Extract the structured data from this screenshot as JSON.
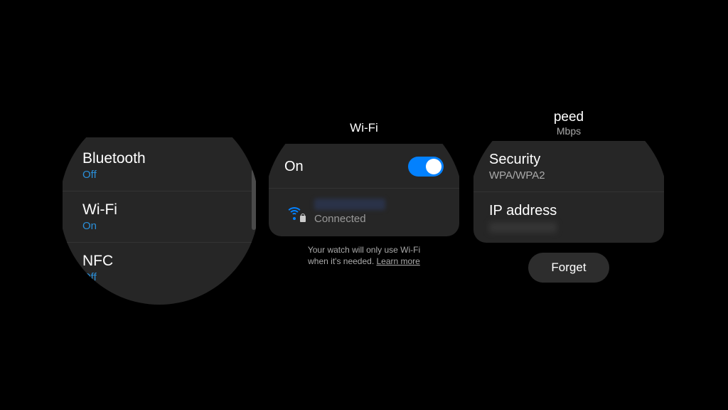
{
  "watch1": {
    "items": [
      {
        "title": "Bluetooth",
        "status": "Off"
      },
      {
        "title": "Wi-Fi",
        "status": "On"
      },
      {
        "title": "NFC",
        "status": "Off"
      }
    ]
  },
  "watch2": {
    "title": "Wi-Fi",
    "toggle": {
      "label": "On",
      "state": true
    },
    "network": {
      "status": "Connected"
    },
    "footer_line1": "Your watch will only use Wi-Fi",
    "footer_line2": "when it's needed. ",
    "learn_more": "Learn more"
  },
  "watch3": {
    "top_suffix": "peed",
    "top_sub": "Mbps",
    "rows": [
      {
        "label": "Security",
        "value": "WPA/WPA2"
      },
      {
        "label": "IP address",
        "value": ""
      }
    ],
    "forget": "Forget"
  }
}
